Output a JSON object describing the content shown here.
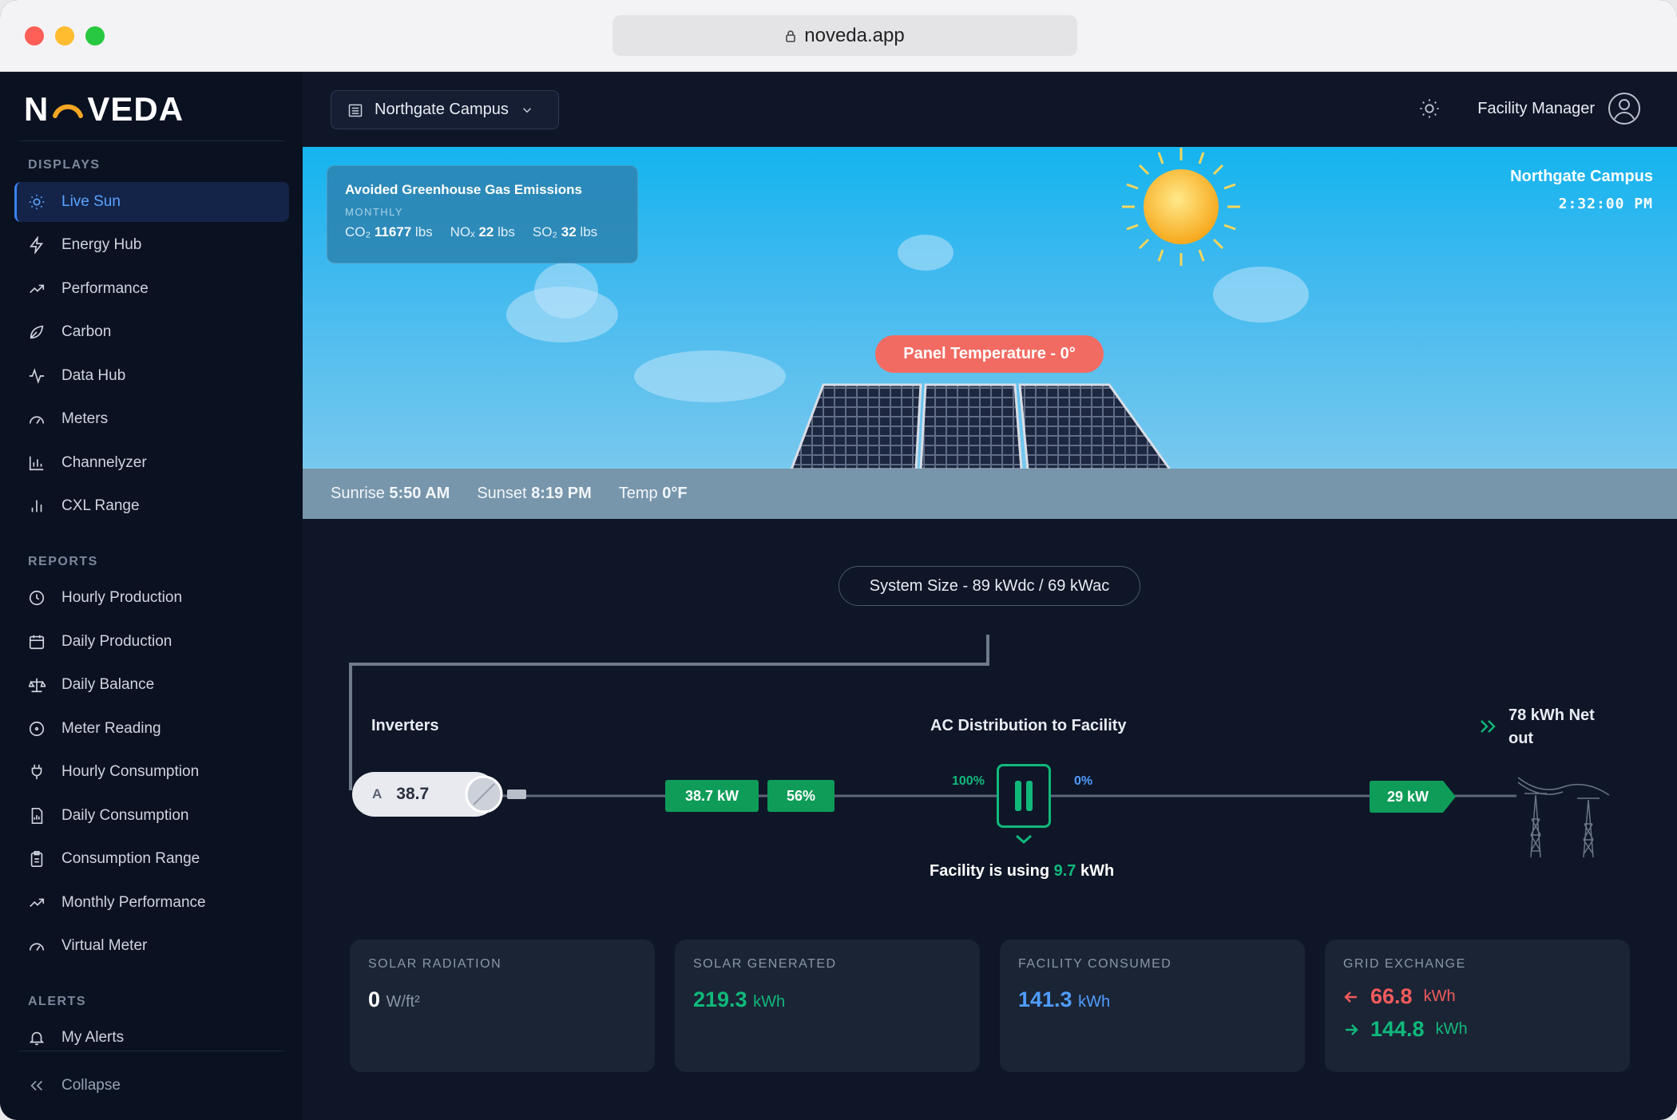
{
  "browser": {
    "url": "noveda.app"
  },
  "brand": {
    "logo_text": "NOVEDA",
    "accent": "#f5a623"
  },
  "sidebar": {
    "displays_heading": "DISPLAYS",
    "displays": [
      {
        "label": "Live Sun",
        "icon": "sun-icon",
        "active": true
      },
      {
        "label": "Energy Hub",
        "icon": "bolt-icon"
      },
      {
        "label": "Performance",
        "icon": "trend-icon"
      },
      {
        "label": "Carbon",
        "icon": "leaf-icon"
      },
      {
        "label": "Data Hub",
        "icon": "pulse-icon"
      },
      {
        "label": "Meters",
        "icon": "gauge-icon"
      },
      {
        "label": "Channelyzer",
        "icon": "bar-chart-icon"
      },
      {
        "label": "CXL Range",
        "icon": "bars-icon"
      }
    ],
    "reports_heading": "REPORTS",
    "reports": [
      {
        "label": "Hourly Production",
        "icon": "clock-icon"
      },
      {
        "label": "Daily Production",
        "icon": "calendar-icon"
      },
      {
        "label": "Daily Balance",
        "icon": "scale-icon"
      },
      {
        "label": "Meter Reading",
        "icon": "dial-icon"
      },
      {
        "label": "Hourly Consumption",
        "icon": "plug-icon"
      },
      {
        "label": "Daily Consumption",
        "icon": "doc-chart-icon"
      },
      {
        "label": "Consumption Range",
        "icon": "clipboard-icon"
      },
      {
        "label": "Monthly Performance",
        "icon": "trend-icon"
      },
      {
        "label": "Virtual Meter",
        "icon": "gauge-icon"
      }
    ],
    "alerts_heading": "ALERTS",
    "alerts": [
      {
        "label": "My Alerts",
        "icon": "bell-icon"
      }
    ],
    "collapse_label": "Collapse"
  },
  "topbar": {
    "campus": "Northgate Campus",
    "user": "Facility Manager"
  },
  "sky": {
    "emissions": {
      "title": "Avoided Greenhouse Gas Emissions",
      "period": "MONTHLY",
      "co2_label": "CO₂",
      "co2_value": "11677",
      "co2_unit": "lbs",
      "nox_label": "NOₓ",
      "nox_value": "22",
      "nox_unit": "lbs",
      "so2_label": "SO₂",
      "so2_value": "32",
      "so2_unit": "lbs"
    },
    "campus": "Northgate Campus",
    "clock": "2:32:00 PM",
    "panel_temperature": "Panel Temperature - 0°",
    "sunrise_label": "Sunrise",
    "sunrise": "5:50 AM",
    "sunset_label": "Sunset",
    "sunset": "8:19 PM",
    "temp_label": "Temp",
    "temp": "0°F"
  },
  "flow": {
    "system_size": "System Size - 89 kWdc / 69 kWac",
    "inverters_label": "Inverters",
    "inverter_id": "A",
    "inverter_value": "38.7",
    "output_kw": "38.7 kW",
    "output_pct": "56%",
    "ac_label": "AC Distribution to Facility",
    "split_left": "100%",
    "split_right": "0%",
    "net_label": "78 kWh Net out",
    "grid_kw": "29 kW",
    "facility_prefix": "Facility is using",
    "facility_value": "9.7",
    "facility_unit": "kWh"
  },
  "stats": {
    "radiation": {
      "label": "SOLAR RADIATION",
      "value": "0",
      "unit": "W/ft²"
    },
    "generated": {
      "label": "SOLAR GENERATED",
      "value": "219.3",
      "unit": "kWh"
    },
    "consumed": {
      "label": "FACILITY CONSUMED",
      "value": "141.3",
      "unit": "kWh"
    },
    "grid": {
      "label": "GRID EXCHANGE",
      "import_value": "66.8",
      "export_value": "144.8",
      "unit": "kWh"
    }
  },
  "colors": {
    "green": "#10b97a",
    "blue": "#4f9dff",
    "red": "#f25b5b"
  }
}
